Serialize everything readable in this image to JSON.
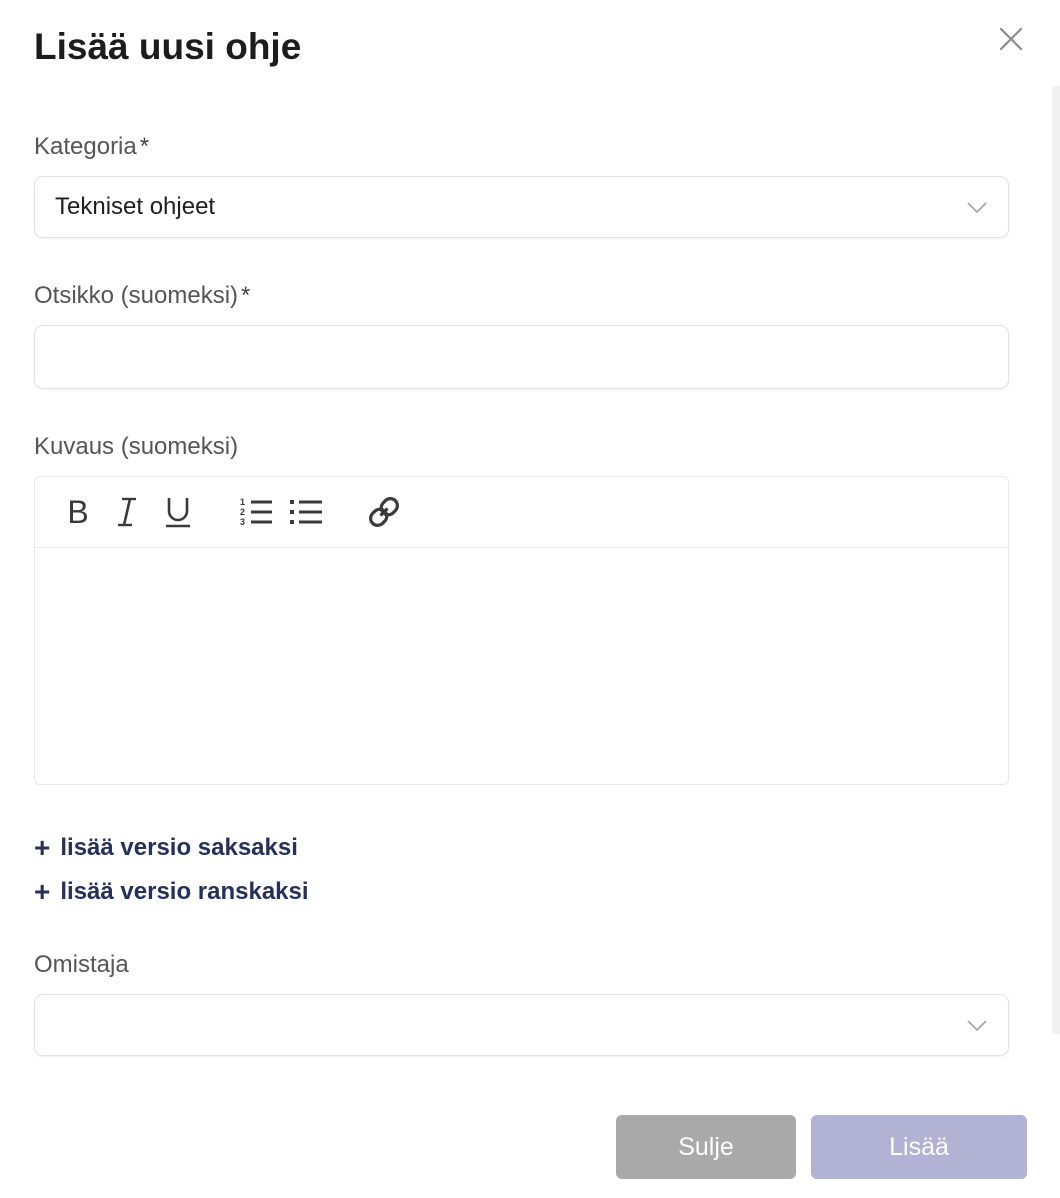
{
  "modal": {
    "title": "Lisää uusi ohje"
  },
  "fields": {
    "category": {
      "label": "Kategoria",
      "required_mark": "*",
      "value": "Tekniset ohjeet"
    },
    "title_fi": {
      "label": "Otsikko (suomeksi)",
      "required_mark": "*",
      "value": ""
    },
    "description_fi": {
      "label": "Kuvaus (suomeksi)",
      "value": ""
    },
    "owner": {
      "label": "Omistaja",
      "value": ""
    }
  },
  "editor": {
    "toolbar": [
      "bold-icon",
      "italic-icon",
      "underline-icon",
      "ordered-list-icon",
      "bullet-list-icon",
      "link-icon"
    ]
  },
  "links": {
    "add_german": "lisää versio saksaksi",
    "add_french": "lisää versio ranskaksi",
    "plus": "+"
  },
  "buttons": {
    "close": "Sulje",
    "add": "Lisää"
  },
  "colors": {
    "link": "#27305a",
    "close_button": "#a9a9a9",
    "add_button_disabled": "#b2b3d4"
  }
}
